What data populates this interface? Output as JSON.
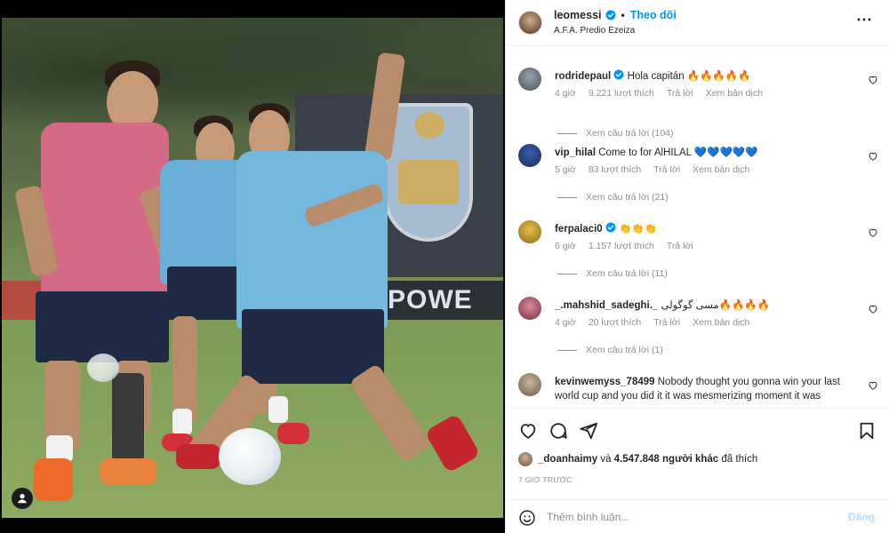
{
  "post": {
    "username": "leomessi",
    "follow_label": "Theo dõi",
    "location": "A.F.A. Predio Ezeiza"
  },
  "photo": {
    "banner_text": "POWE"
  },
  "comments": [
    {
      "username": "rodridepaul",
      "verified": true,
      "text": "Hola capitán 🔥🔥🔥🔥🔥",
      "time": "4 giờ",
      "likes": "9.221 lượt thích",
      "reply_label": "Trả lời",
      "translate_label": "Xem bản dịch",
      "view_replies": "Xem câu trả lời (104)"
    },
    {
      "username": "vip_hilal",
      "verified": false,
      "text": "Come to for AlHILAL 💙💙💙💙💙",
      "time": "5 giờ",
      "likes": "83 lượt thích",
      "reply_label": "Trả lời",
      "translate_label": "Xem bản dịch",
      "view_replies": "Xem câu trả lời (21)"
    },
    {
      "username": "ferpalaci0",
      "verified": true,
      "text": "👏👏👏",
      "time": "6 giờ",
      "likes": "1.157 lượt thích",
      "reply_label": "Trả lời",
      "translate_label": "",
      "view_replies": "Xem câu trả lời (11)"
    },
    {
      "username": "_.mahshid_sadeghi._",
      "verified": false,
      "text": "مسی گوگولی🔥🔥🔥🔥",
      "time": "4 giờ",
      "likes": "20 lượt thích",
      "reply_label": "Trả lời",
      "translate_label": "Xem bản dịch",
      "view_replies": "Xem câu trả lời (1)"
    },
    {
      "username": "kevinwemyss_78499",
      "verified": false,
      "text": "Nobody thought you gonna win your last world cup and you did it it was mesmerizing moment it was"
    }
  ],
  "actions": {
    "like_icon": "heart-outline-icon",
    "comment_icon": "comment-bubble-icon",
    "share_icon": "paper-plane-icon",
    "save_icon": "bookmark-icon"
  },
  "likes_summary": {
    "first_user": "_doanhaimy",
    "middle": "và",
    "others_count": "4.547.848 người khác",
    "suffix": "đã thích"
  },
  "timestamp": "7 GIỜ TRƯỚC",
  "composer": {
    "placeholder": "Thêm bình luận...",
    "post_label": "Đăng"
  },
  "colors": {
    "accent": "#0095f6",
    "post_disabled": "#b2dffc",
    "muted": "#8e8e8e"
  }
}
